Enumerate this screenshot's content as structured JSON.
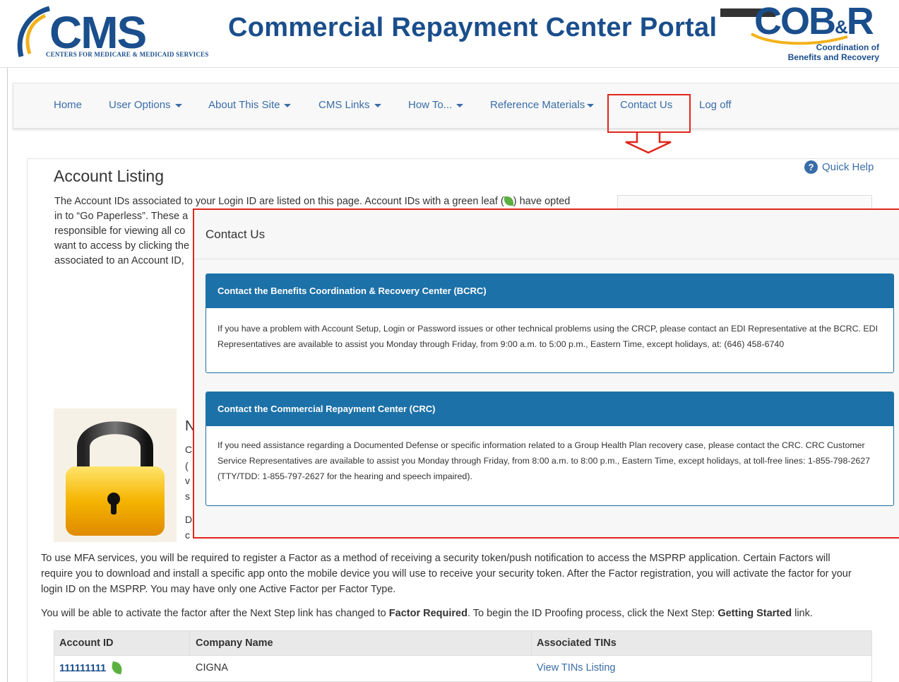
{
  "header": {
    "cms_logo_text": "CMS",
    "cms_logo_subtitle": "CENTERS FOR MEDICARE & MEDICAID SERVICES",
    "portal_title": "Commercial Repayment Center Portal",
    "cobr_logo_main": "COB",
    "cobr_logo_amp": "&",
    "cobr_logo_r": "R",
    "cobr_sub_line1": "Coordination of",
    "cobr_sub_line2": "Benefits and Recovery"
  },
  "nav": {
    "home": "Home",
    "user_options": "User Options",
    "about": "About This Site",
    "cms_links": "CMS Links",
    "how_to": "How To...",
    "reference": "Reference Materials",
    "contact": "Contact Us",
    "logoff": "Log off"
  },
  "page": {
    "heading": "Account Listing",
    "quick_help": "Quick Help",
    "intro_line1_pre": "The Account IDs associated to your Login ID are listed on this page. Account IDs with a green leaf (",
    "intro_line1_post": ") have opted",
    "intro_line2": "in to “Go Paperless”. These a",
    "intro_line3": "responsible for viewing all co",
    "intro_line4": "want to access by clicking the",
    "intro_line5": "associated to an Account ID,",
    "side_letters": [
      "N",
      "C",
      "(",
      "v",
      "s",
      "D",
      "c"
    ]
  },
  "modal": {
    "title": "Contact Us",
    "cards": [
      {
        "heading": "Contact the Benefits Coordination & Recovery Center (BCRC)",
        "lines": [
          "If you have a problem with Account Setup, Login or Password issues or other technical problems using the CRCP, please contact an EDI Representative at the BCRC. EDI",
          "Representatives are available to assist you Monday through Friday, from 9:00 a.m. to 5:00 p.m., Eastern Time, except holidays, at: (646) 458-6740"
        ]
      },
      {
        "heading": "Contact the Commercial Repayment Center (CRC)",
        "lines": [
          "If you need assistance regarding a Documented Defense or specific information related to a Group Health Plan recovery case, please contact the CRC. CRC Customer",
          "Service Representatives are available to assist you Monday through Friday, from 8:00 a.m. to 8:00 p.m., Eastern Time, except holidays, at toll-free lines: 1-855-798-2627",
          "(TTY/TDD: 1-855-797-2627 for the hearing and speech impaired)."
        ]
      }
    ]
  },
  "mfa": {
    "para1_line1": "To use MFA services, you will be required to register a Factor as a method of receiving a security token/push notification to access the MSPRP application. Certain Factors will",
    "para1_line2": "require you to download and install a specific app onto the mobile device you will use to receive your security token. After the Factor registration, you will activate the factor for your",
    "para1_line3": "login ID on the MSPRP. You may have only one Active Factor per Factor Type.",
    "para2_a": "You will be able to activate the factor after the Next Step link has changed to ",
    "para2_b": "Factor Required",
    "para2_c": ". To begin the ID Proofing process, click the Next Step: ",
    "para2_d": "Getting Started",
    "para2_e": " link."
  },
  "table": {
    "headers": [
      "Account ID",
      "Company Name",
      "Associated TINs"
    ],
    "rows": [
      {
        "account_id": "111111111",
        "company": "CIGNA",
        "tins": "View TINs Listing"
      }
    ]
  },
  "colors": {
    "brand_blue": "#1a4e8c",
    "link_blue": "#3a6da8",
    "card_header": "#1c71a8",
    "highlight_red": "#e0261c",
    "leaf_green": "#5cb040"
  }
}
